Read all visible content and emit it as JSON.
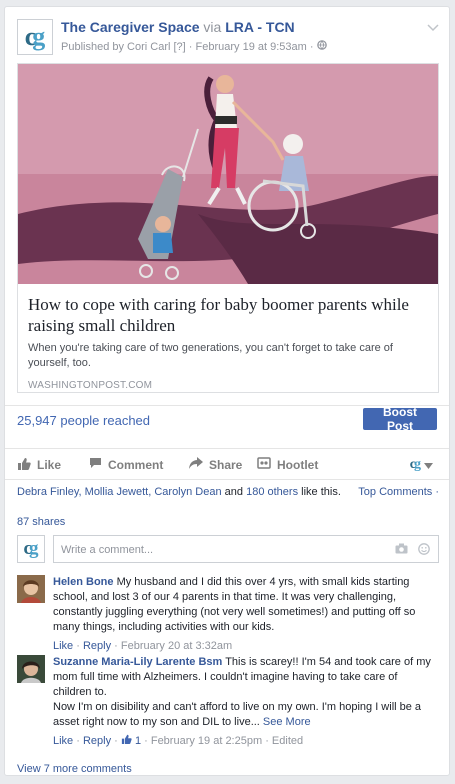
{
  "post": {
    "page_name": "The Caregiver Space",
    "via": "via",
    "via_page": "LRA - TCN",
    "published_by": "Published by Cori Carl",
    "question_mark": "[?]",
    "separator": "·",
    "date": "February 19 at 9:53am"
  },
  "link": {
    "headline": "How to cope with caring for baby boomer parents while raising small children",
    "description": "When you're taking care of two generations, you can't forget to take care of yourself, too.",
    "domain": "WASHINGTONPOST.COM"
  },
  "reach": {
    "text": "25,947 people reached",
    "boost_label": "Boost Post"
  },
  "actions": {
    "like": "Like",
    "comment": "Comment",
    "share": "Share",
    "hootlet": "Hootlet"
  },
  "likes": {
    "names": "Debra Finley, Mollia Jewett, Carolyn Dean",
    "and": "and",
    "others": "180 others",
    "suffix": "like this.",
    "top_comments": "Top Comments ·"
  },
  "shares": "87 shares",
  "write_comment_placeholder": "Write a comment...",
  "comments": [
    {
      "name": "Helen Bone",
      "text": "My husband and I did this over 4 yrs, with small kids starting school, and lost 3 of our 4 parents in that time. It was very challenging, constantly juggling everything (not very well sometimes!) and putting off so many things, including activities with our kids.",
      "like": "Like",
      "reply": "Reply",
      "date": "February 20 at 3:32am"
    },
    {
      "name": "Suzanne Maria-Lily Larente Bsm",
      "text": "This is scarey!! I'm 54 and took care of my mom full time with Alzheimers. I couldn't imagine having to take care of children to.",
      "text2": "Now I'm on disibility and can't afford to live on my own. I'm hoping I will be a asset right now to my son and DIL to live...",
      "see_more": "See More",
      "like": "Like",
      "reply": "Reply",
      "like_count": "1",
      "date": "February 19 at 2:25pm",
      "edited": "Edited"
    }
  ],
  "view_more": "View 7 more comments",
  "colors": {
    "link_blue": "#365899",
    "button_blue": "#4267b2",
    "illustration_bg": "#c9859c",
    "road": "#6a3350"
  }
}
